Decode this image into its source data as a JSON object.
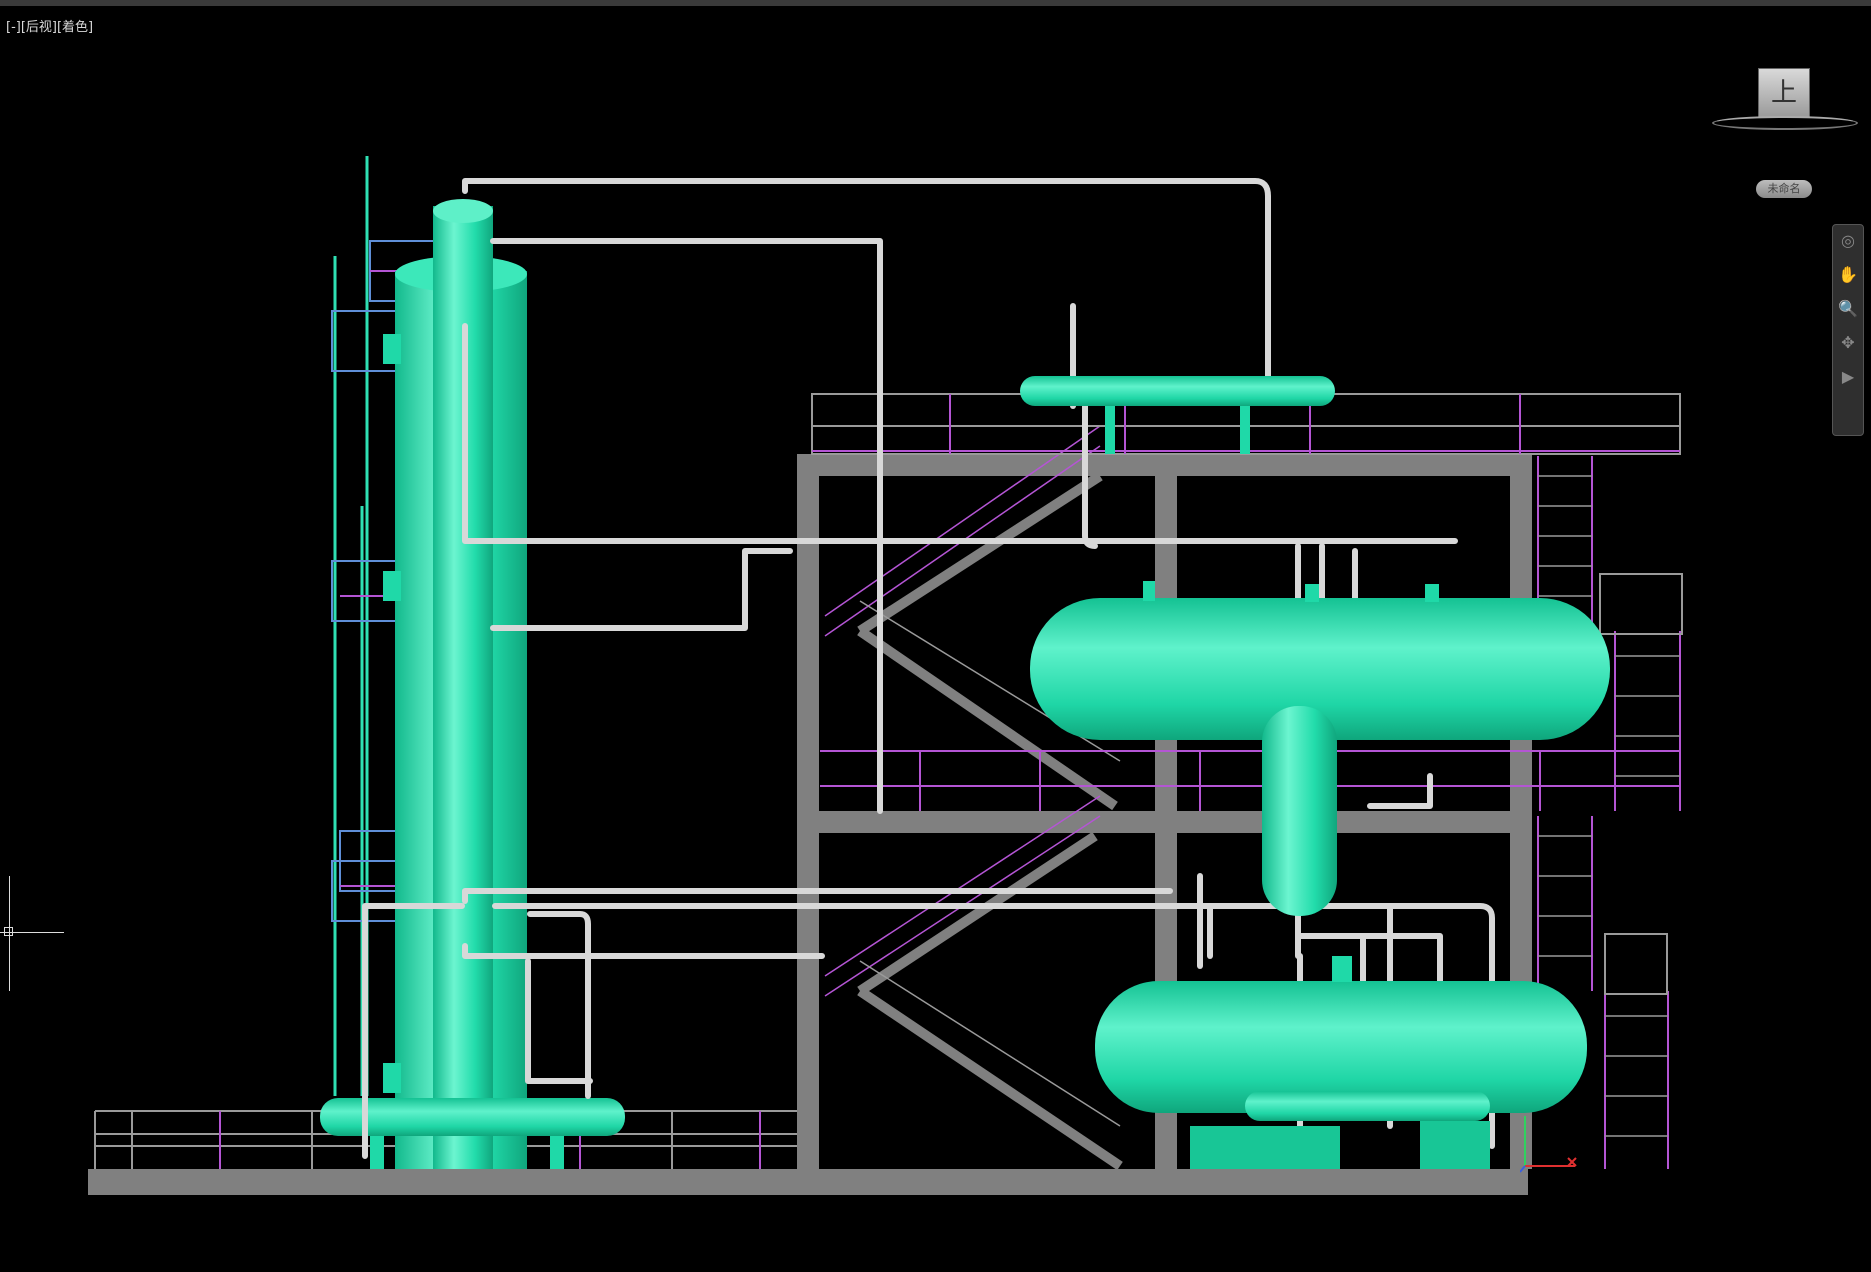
{
  "viewport": {
    "label": "[-][后视][着色]"
  },
  "viewcube": {
    "face_label": "上",
    "wcs_label": "未命名"
  },
  "navbar": {
    "icons": [
      "steering-wheel-icon",
      "pan-icon",
      "zoom-icon",
      "orbit-icon",
      "showmotion-icon"
    ],
    "glyphs": [
      "◎",
      "✋",
      "🔍",
      "✥",
      "▶"
    ]
  },
  "colors": {
    "background": "#000000",
    "equipment": "#1fd9a8",
    "equipment_highlight": "#6cf5d0",
    "steel": "#808080",
    "railing_gray": "#9a9a9a",
    "railing_magenta": "#b455d4",
    "pipe": "#d8d8d8",
    "ladder": "#2fe0b4"
  }
}
